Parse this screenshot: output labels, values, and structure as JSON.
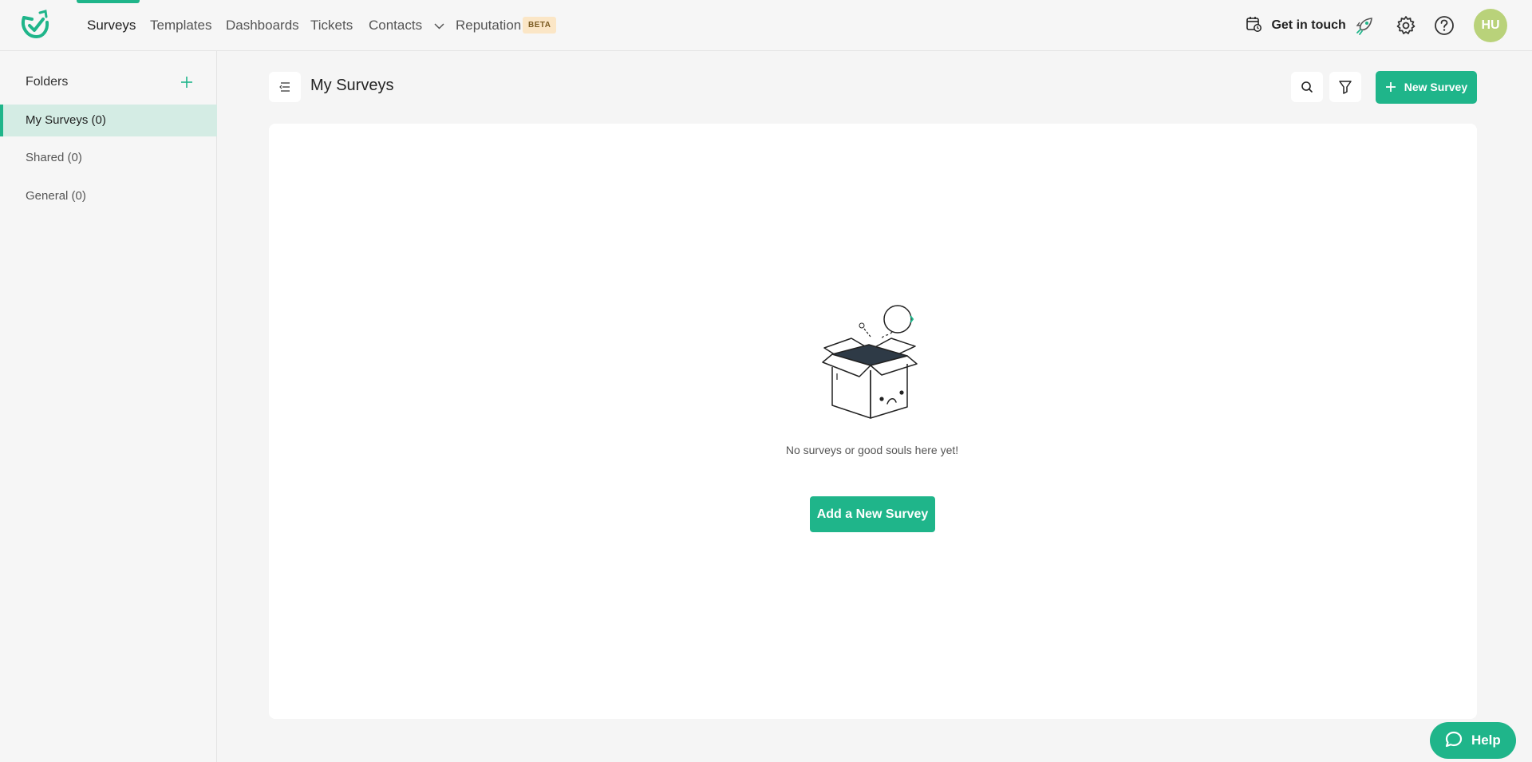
{
  "app": {
    "logo_icon": "survey-bird-logo-icon",
    "accent_color": "#1fb58a"
  },
  "nav": {
    "items": [
      {
        "label": "Surveys",
        "active": true
      },
      {
        "label": "Templates"
      },
      {
        "label": "Dashboards"
      },
      {
        "label": "Tickets"
      },
      {
        "label": "Contacts",
        "icon": "chevron-down-icon"
      },
      {
        "label": "Reputation"
      }
    ],
    "beta_badge": "BETA",
    "get_in_touch": "Get in touch",
    "avatar_initials": "HU"
  },
  "sidebar": {
    "title": "Folders",
    "items": [
      {
        "label": "My Surveys (0)",
        "active": true
      },
      {
        "label": "Shared (0)"
      },
      {
        "label": "General (0)"
      }
    ]
  },
  "main": {
    "title": "My Surveys",
    "new_survey_label": "New Survey",
    "empty_message": "No surveys or good souls here yet!",
    "add_survey_label": "Add a New Survey"
  },
  "help": {
    "label": "Help"
  }
}
